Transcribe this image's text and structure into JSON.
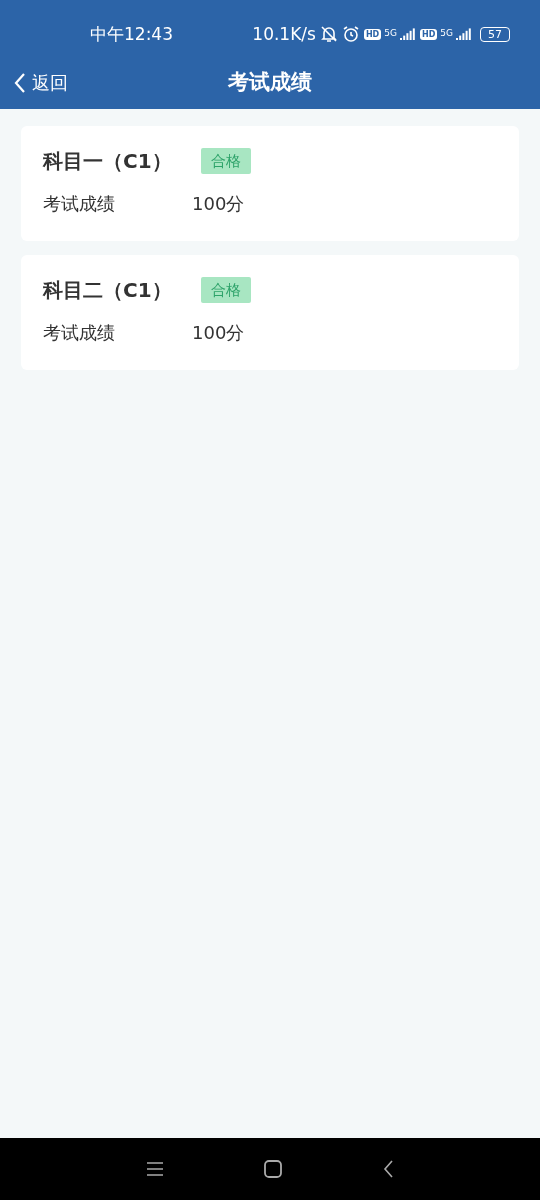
{
  "status_bar": {
    "time": "中午12:43",
    "speed": "10.1K/s",
    "sims": [
      {
        "hd": "HD",
        "network": "5G"
      },
      {
        "hd": "HD",
        "network": "5G"
      }
    ],
    "battery": "57"
  },
  "nav": {
    "back": "返回",
    "title": "考试成绩"
  },
  "results": [
    {
      "subject": "科目一（C1）",
      "status": "合格",
      "passed": true,
      "label": "考试成绩",
      "score": "100分"
    },
    {
      "subject": "科目二（C1）",
      "status": "合格",
      "passed": true,
      "label": "考试成绩",
      "score": "100分"
    }
  ]
}
